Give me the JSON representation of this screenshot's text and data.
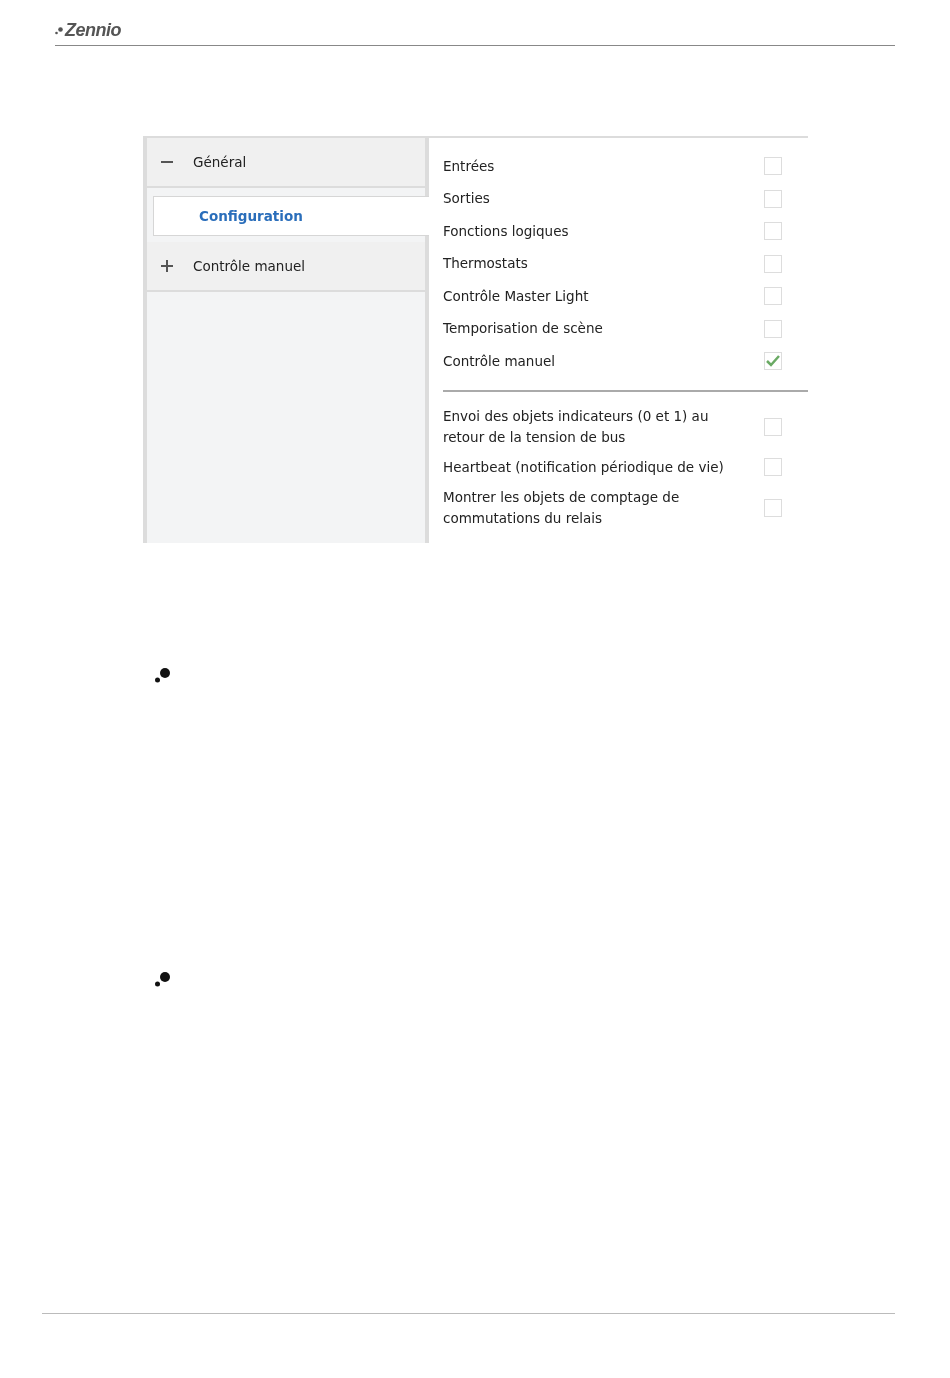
{
  "header": {
    "logo": "Zennio"
  },
  "sidebar": {
    "items": [
      {
        "label": "Général",
        "expanded": true,
        "children": [
          {
            "label": "Configuration",
            "selected": true
          }
        ]
      },
      {
        "label": "Contrôle manuel",
        "expanded": false
      }
    ]
  },
  "parameters": {
    "groups": [
      {
        "items": [
          {
            "label": "Entrées",
            "checked": false
          },
          {
            "label": "Sorties",
            "checked": false
          },
          {
            "label": "Fonctions logiques",
            "checked": false
          },
          {
            "label": "Thermostats",
            "checked": false
          },
          {
            "label": "Contrôle Master Light",
            "checked": false
          },
          {
            "label": "Temporisation de scène",
            "checked": false
          },
          {
            "label": "Contrôle manuel",
            "checked": true
          }
        ]
      },
      {
        "items": [
          {
            "label": "Envoi des objets indicateurs (0 et 1) au retour de la tension de bus",
            "checked": false
          },
          {
            "label": "Heartbeat (notification périodique de vie)",
            "checked": false
          },
          {
            "label": "Montrer les objets de comptage de commutations du relais",
            "checked": false
          }
        ]
      }
    ]
  }
}
